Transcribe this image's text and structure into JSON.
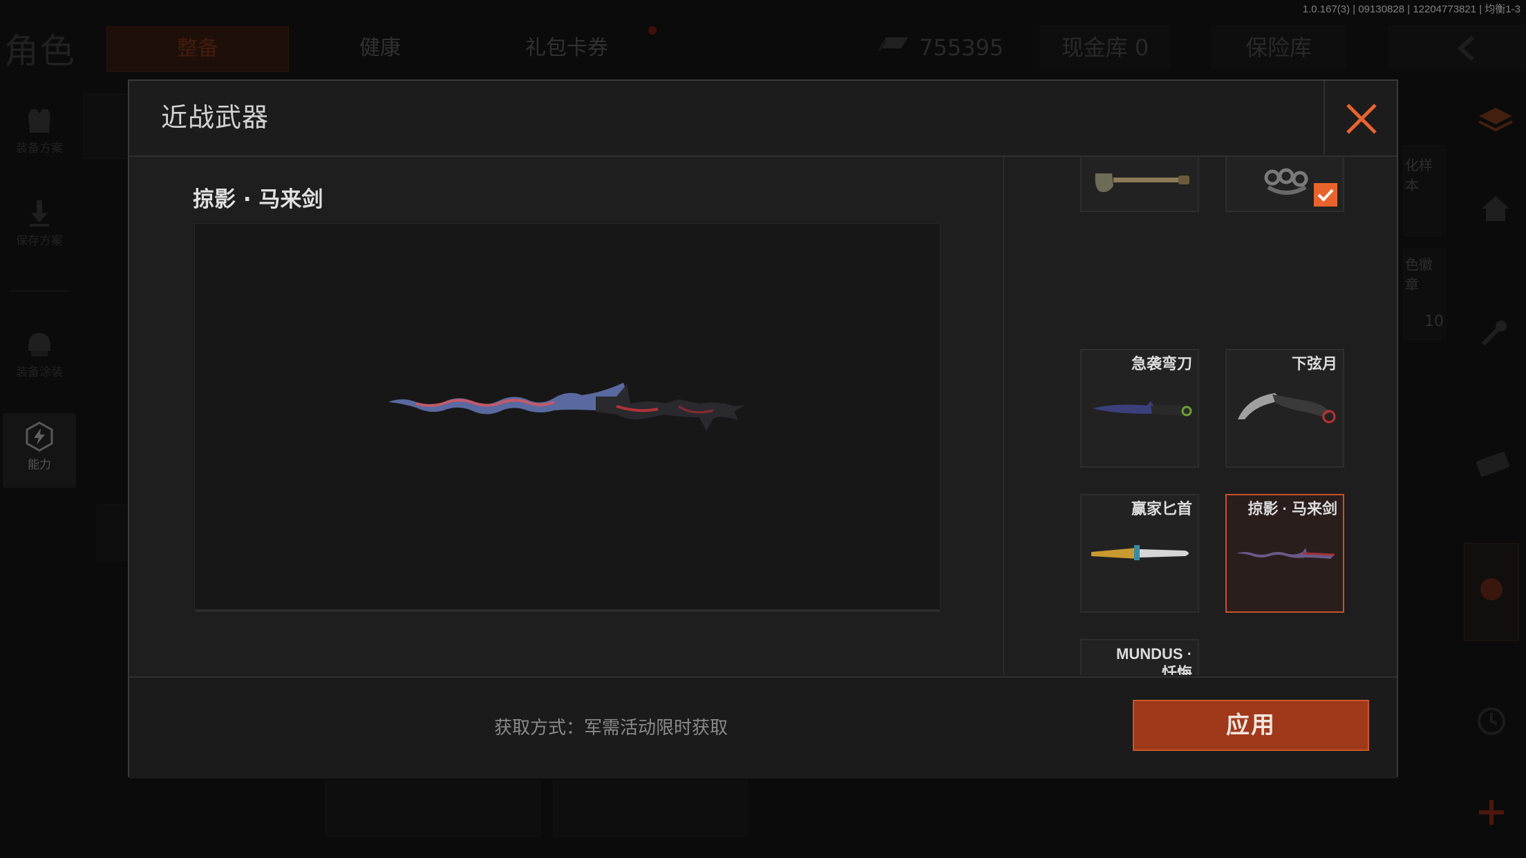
{
  "version_info": "1.0.167(3) | 09130828 | 12204773821 | 均衡1-3",
  "header": {
    "page_title": "角色",
    "tabs": [
      {
        "label": "整备",
        "active": true
      },
      {
        "label": "健康",
        "active": false
      },
      {
        "label": "礼包卡券",
        "active": false
      }
    ],
    "money": "755395",
    "cash_vault": "现金库 0",
    "insurance": "保险库"
  },
  "left_rail": {
    "items": [
      {
        "label": "装备方案",
        "icon": "vest-icon"
      },
      {
        "label": "保存方案",
        "icon": "download-icon"
      },
      {
        "label": "装备涂装",
        "icon": "helmet-icon"
      },
      {
        "label": "能力",
        "icon": "ability-icon"
      }
    ]
  },
  "background_fragments": {
    "sample_text": "化样本",
    "badge_text": "色徽章",
    "badge_count": "10"
  },
  "modal": {
    "title": "近战武器",
    "selected_weapon_name": "掠影 · 马来剑",
    "weapons": [
      {
        "label": "",
        "icon": "shovel-icon",
        "equipped": false,
        "selected": false
      },
      {
        "label": "",
        "icon": "knuckle-icon",
        "equipped": true,
        "selected": false
      },
      {
        "label": "急袭弯刀",
        "icon": "curved-blade-icon",
        "equipped": false,
        "selected": false
      },
      {
        "label": "下弦月",
        "icon": "karambit-icon",
        "equipped": false,
        "selected": false
      },
      {
        "label": "赢家匕首",
        "icon": "dagger-icon",
        "equipped": false,
        "selected": false
      },
      {
        "label": "掠影 · 马来剑",
        "icon": "kris-icon",
        "equipped": false,
        "selected": true
      },
      {
        "label": "MUNDUS · 忏悔",
        "icon": "ornate-blade-icon",
        "equipped": false,
        "selected": false
      }
    ],
    "source_text": "获取方式：军需活动限时获取",
    "apply_label": "应用",
    "colors": {
      "accent": "#c9512b",
      "apply_bg": "#a0391a",
      "close": "#e8642c"
    }
  }
}
